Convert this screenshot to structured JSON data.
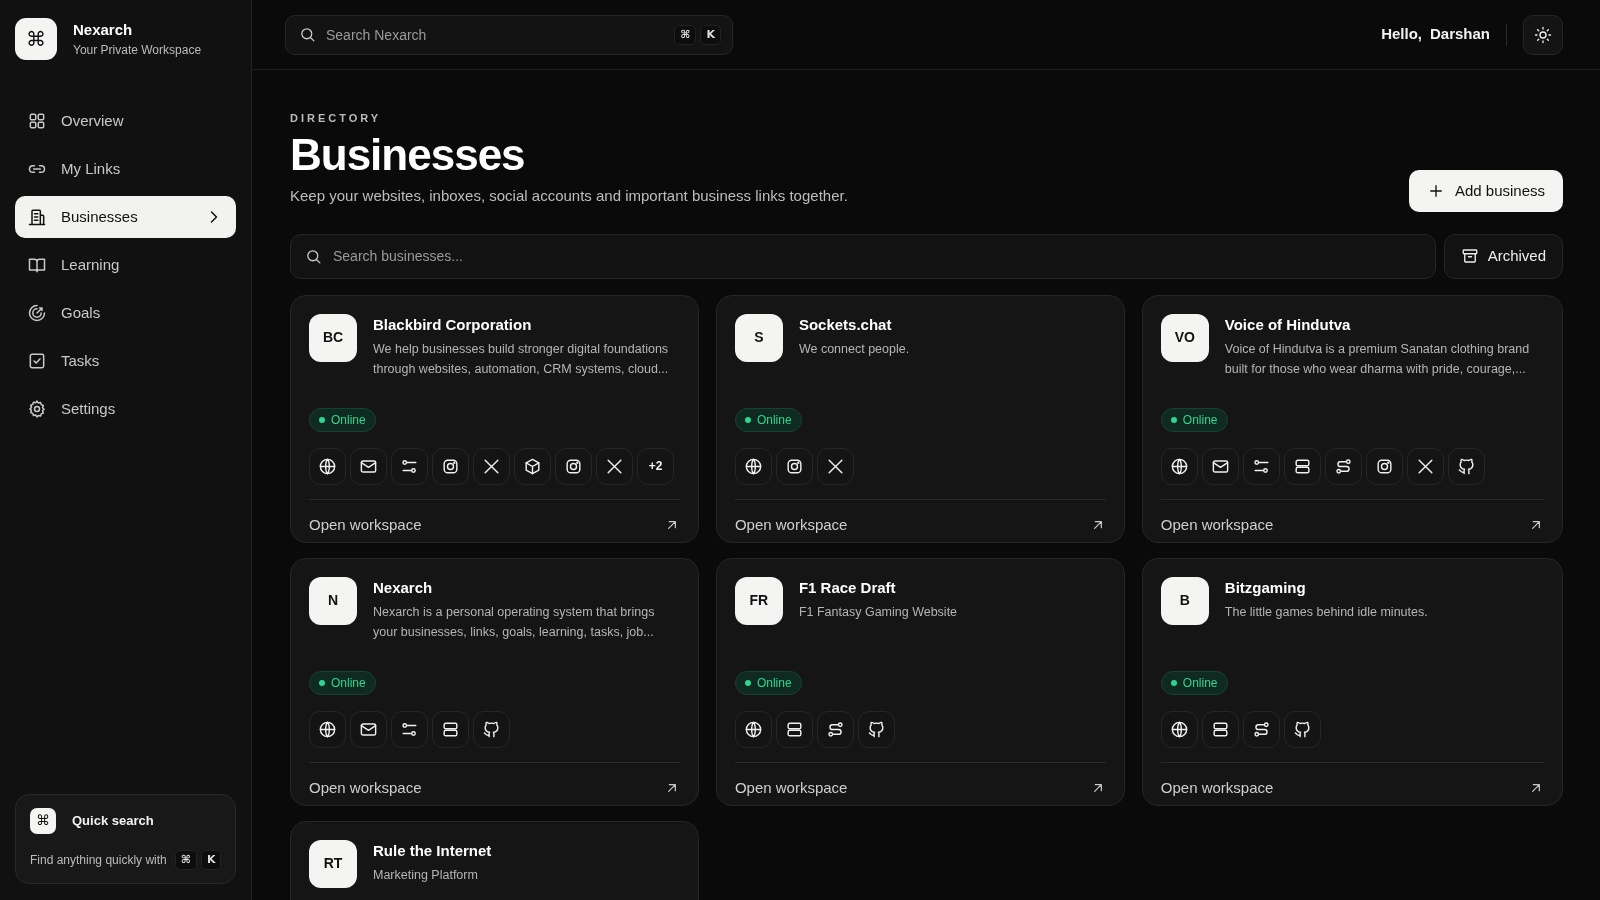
{
  "brand": {
    "logo_glyph": "⌘",
    "name": "Nexarch",
    "tagline": "Your Private Workspace"
  },
  "sidebar": {
    "items": [
      {
        "kind": "grid",
        "label": "Overview",
        "selected": false
      },
      {
        "kind": "link",
        "label": "My Links",
        "selected": false
      },
      {
        "kind": "building",
        "label": "Businesses",
        "selected": true
      },
      {
        "kind": "book",
        "label": "Learning",
        "selected": false
      },
      {
        "kind": "target",
        "label": "Goals",
        "selected": false
      },
      {
        "kind": "task",
        "label": "Tasks",
        "selected": false
      },
      {
        "kind": "gear",
        "label": "Settings",
        "selected": false
      }
    ],
    "quick_search": {
      "glyph": "⌘",
      "title": "Quick search",
      "hint": "Find anything quickly with",
      "keys": [
        "⌘",
        "K"
      ]
    }
  },
  "topbar": {
    "search": {
      "placeholder": "Search Nexarch",
      "keys": [
        "⌘",
        "K"
      ]
    },
    "greeting": "Hello,",
    "user_name": "Darshan"
  },
  "header": {
    "eyebrow": "DIRECTORY",
    "title": "Businesses",
    "subtitle": "Keep your websites, inboxes, social accounts and important business links together.",
    "add_button": "Add business"
  },
  "filter": {
    "placeholder": "Search businesses...",
    "archived_button": "Archived"
  },
  "businesses": [
    {
      "initials": "BC",
      "name": "Blackbird Corporation",
      "description": "We help businesses build stronger digital foundations through websites, automation, CRM systems, cloud...",
      "status": "Online",
      "links": [
        {
          "kind": "globe"
        },
        {
          "kind": "mail"
        },
        {
          "kind": "sliders"
        },
        {
          "kind": "camera"
        },
        {
          "kind": "x"
        },
        {
          "kind": "cube"
        },
        {
          "kind": "camera"
        },
        {
          "kind": "x"
        }
      ],
      "more": "+2",
      "action": "Open workspace"
    },
    {
      "initials": "S",
      "name": "Sockets.chat",
      "description": "We connect people.",
      "status": "Online",
      "links": [
        {
          "kind": "globe"
        },
        {
          "kind": "camera"
        },
        {
          "kind": "x"
        }
      ],
      "action": "Open workspace"
    },
    {
      "initials": "VO",
      "name": "Voice of Hindutva",
      "description": "Voice of Hindutva is a premium Sanatan clothing brand built for those who wear dharma with pride, courage,...",
      "status": "Online",
      "links": [
        {
          "kind": "globe"
        },
        {
          "kind": "mail"
        },
        {
          "kind": "sliders"
        },
        {
          "kind": "server"
        },
        {
          "kind": "route"
        },
        {
          "kind": "camera"
        },
        {
          "kind": "x"
        },
        {
          "kind": "github"
        }
      ],
      "action": "Open workspace"
    },
    {
      "initials": "N",
      "name": "Nexarch",
      "description": "Nexarch is a personal operating system that brings your businesses, links, goals, learning, tasks, job...",
      "status": "Online",
      "links": [
        {
          "kind": "globe"
        },
        {
          "kind": "mail"
        },
        {
          "kind": "sliders"
        },
        {
          "kind": "server"
        },
        {
          "kind": "github"
        }
      ],
      "action": "Open workspace"
    },
    {
      "initials": "FR",
      "name": "F1 Race Draft",
      "description": "F1 Fantasy Gaming Website",
      "status": "Online",
      "links": [
        {
          "kind": "globe"
        },
        {
          "kind": "server"
        },
        {
          "kind": "route"
        },
        {
          "kind": "github"
        }
      ],
      "action": "Open workspace"
    },
    {
      "initials": "B",
      "name": "Bitzgaming",
      "description": "The little games behind idle minutes.",
      "status": "Online",
      "links": [
        {
          "kind": "globe"
        },
        {
          "kind": "server"
        },
        {
          "kind": "route"
        },
        {
          "kind": "github"
        }
      ],
      "action": "Open workspace"
    },
    {
      "initials": "RT",
      "name": "Rule the Internet",
      "description": "Marketing Platform"
    }
  ]
}
